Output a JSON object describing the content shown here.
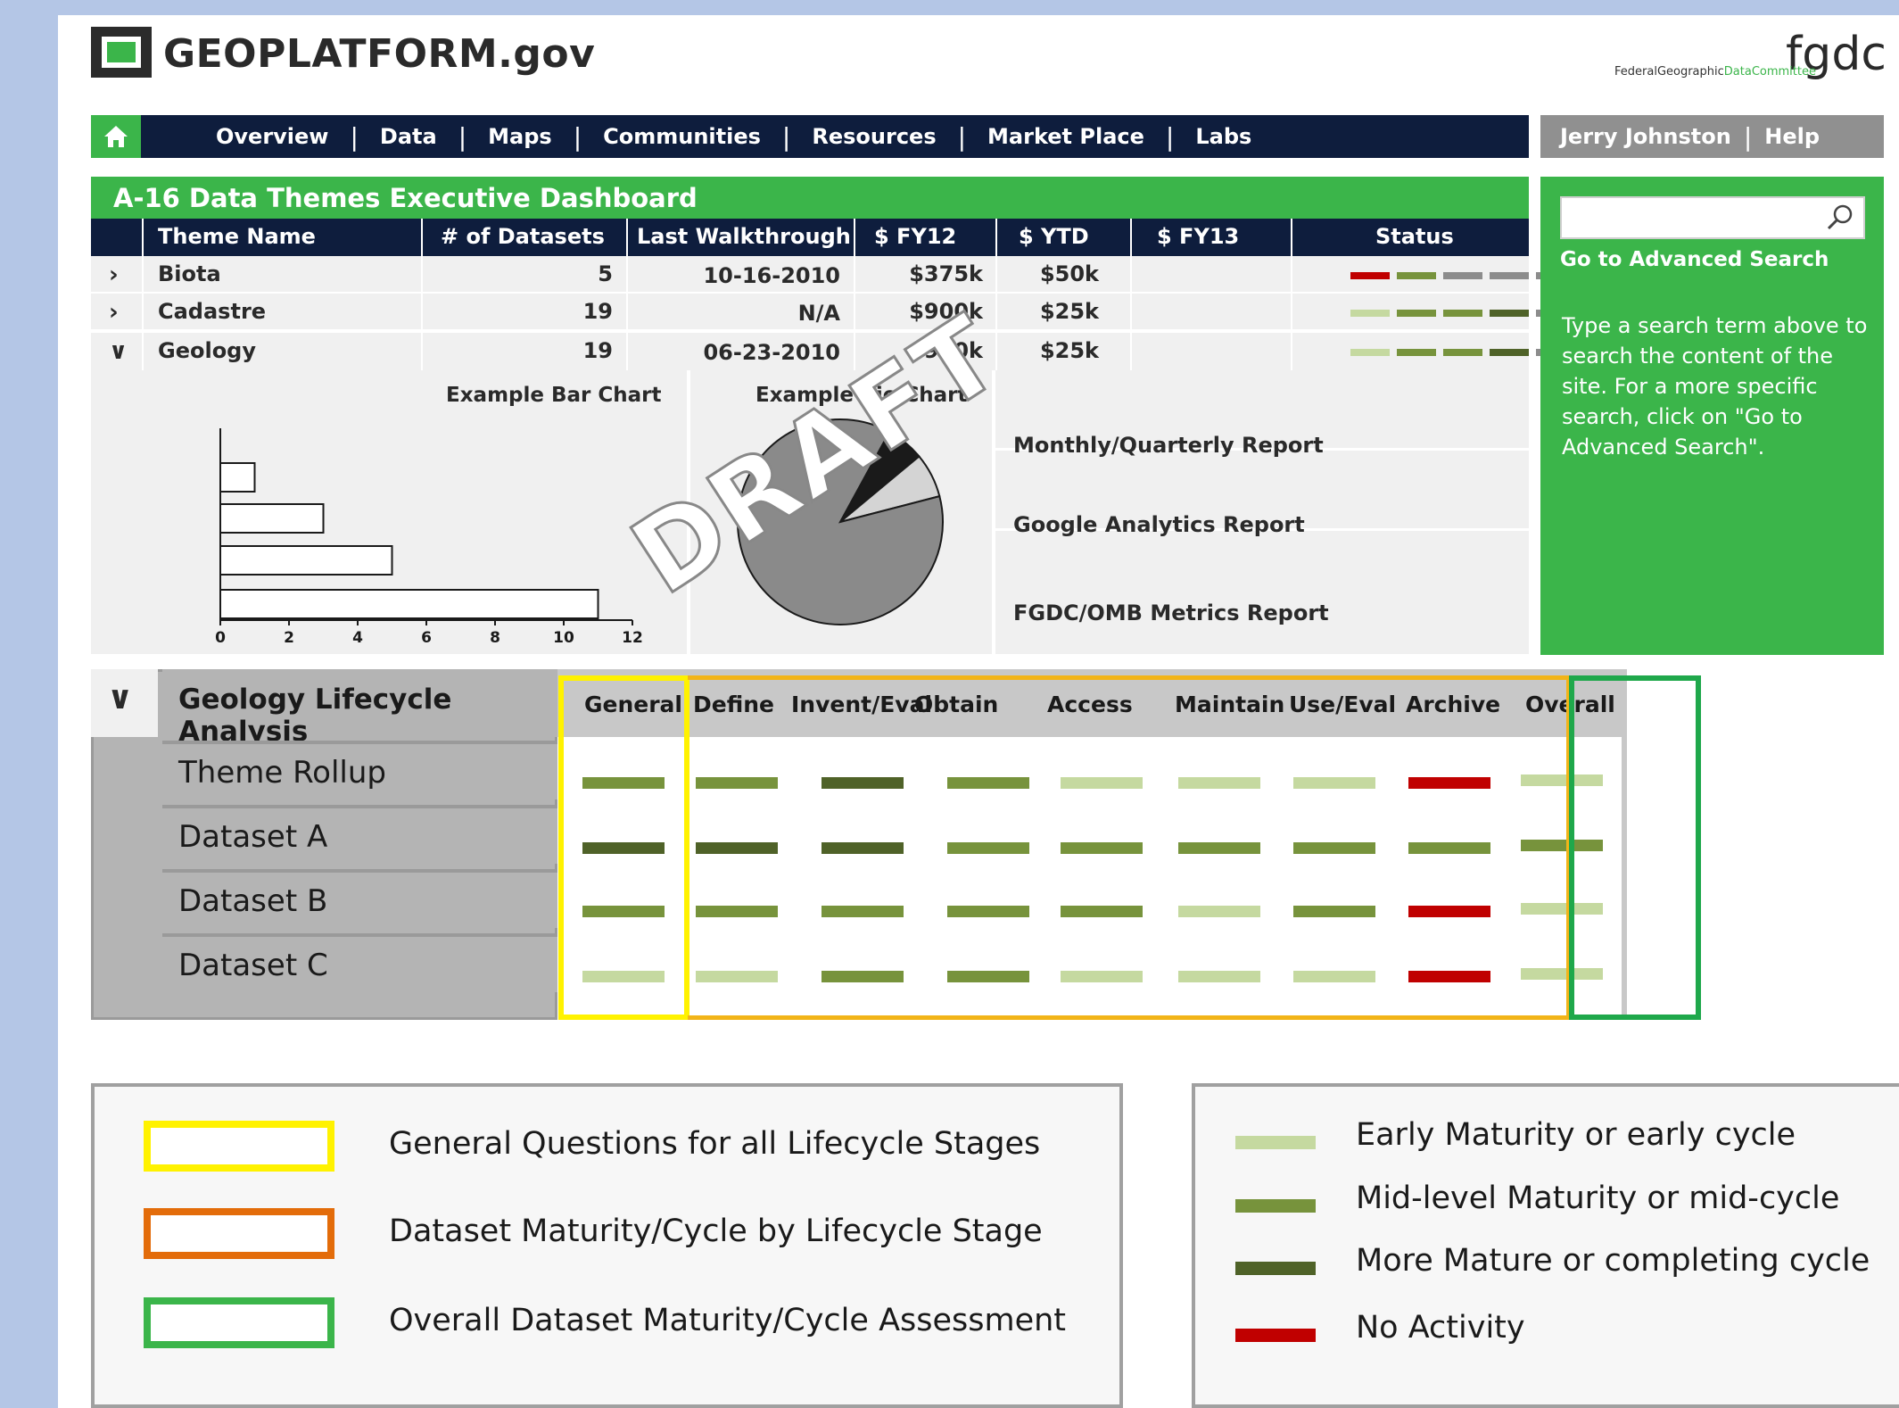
{
  "header": {
    "site_title": "GEOPLATFORM.gov",
    "partner_logo": "fgdc",
    "partner_sub_1": "FederalGeographic",
    "partner_sub_2": "DataCommittee"
  },
  "nav": {
    "home_icon": "home-icon",
    "items": [
      "Overview",
      "Data",
      "Maps",
      "Communities",
      "Resources",
      "Market Place",
      "Labs"
    ],
    "user": "Jerry Johnston",
    "help": "Help"
  },
  "dashboard": {
    "title": "A-16 Data Themes Executive Dashboard",
    "columns": [
      "Theme Name",
      "# of Datasets",
      "Last Walkthrough",
      "$ FY12",
      "$ YTD",
      "$ FY13",
      "Status"
    ],
    "rows": [
      {
        "expanded": false,
        "chevron": "›",
        "name": "Biota",
        "datasets": "5",
        "walkthrough": "10-16-2010",
        "fy12": "$375k",
        "ytd": "$50k",
        "fy13": "",
        "status": [
          "red",
          "mid",
          "gray",
          "gray",
          "gray"
        ]
      },
      {
        "expanded": false,
        "chevron": "›",
        "name": "Cadastre",
        "datasets": "19",
        "walkthrough": "N/A",
        "fy12": "$900k",
        "ytd": "$25k",
        "fy13": "",
        "status": [
          "light",
          "mid",
          "mid",
          "dark",
          "gray"
        ]
      },
      {
        "expanded": true,
        "chevron": "∨",
        "name": "Geology",
        "datasets": "19",
        "walkthrough": "06-23-2010",
        "fy12": "$900k",
        "ytd": "$25k",
        "fy13": "",
        "status": [
          "light",
          "mid",
          "mid",
          "dark",
          "gray"
        ]
      }
    ]
  },
  "bar_chart": {
    "title": "Example Bar Chart",
    "ticks": [
      "0",
      "2",
      "4",
      "6",
      "8",
      "10",
      "12"
    ]
  },
  "pie_chart": {
    "title": "Example Pie Chart"
  },
  "chart_data": [
    {
      "type": "bar",
      "title": "Example Bar Chart",
      "orientation": "horizontal",
      "values": [
        1,
        3,
        5,
        11
      ],
      "xlim": [
        0,
        12
      ]
    },
    {
      "type": "pie",
      "title": "Example Pie Chart",
      "values": [
        6,
        7,
        87
      ]
    }
  ],
  "watermark": "DRAFT",
  "reports": [
    "Monthly/Quarterly Report",
    "Google Analytics Report",
    "FGDC/OMB Metrics Report"
  ],
  "search": {
    "placeholder": "",
    "icon": "search-icon",
    "advanced_link": "Go to Advanced Search",
    "help_text": "Type a search term above to search the content of the site.  For a more specific search, click on \"Go to Advanced Search\"."
  },
  "lifecycle": {
    "title": "Geology Lifecycle Analysis",
    "columns": [
      "General",
      "Define",
      "Invent/Eval",
      "Obtain",
      "Access",
      "Maintain",
      "Use/Eval",
      "Archive",
      "Overall"
    ],
    "rows": [
      {
        "label": "Theme Rollup",
        "cells": [
          "mid",
          "mid",
          "dark",
          "mid",
          "light",
          "light",
          "light",
          "red",
          "light"
        ]
      },
      {
        "label": "Dataset A",
        "cells": [
          "dark",
          "dark",
          "dark",
          "mid",
          "mid",
          "mid",
          "mid",
          "mid",
          "mid"
        ]
      },
      {
        "label": "Dataset B",
        "cells": [
          "mid",
          "mid",
          "mid",
          "mid",
          "mid",
          "light",
          "mid",
          "red",
          "light"
        ]
      },
      {
        "label": "Dataset C",
        "cells": [
          "light",
          "light",
          "mid",
          "mid",
          "light",
          "light",
          "light",
          "red",
          "light"
        ]
      }
    ]
  },
  "legend_boxes": [
    {
      "color": "#fff200",
      "label": "General Questions for all Lifecycle Stages"
    },
    {
      "color": "#e36c0a",
      "label": "Dataset Maturity/Cycle by Lifecycle Stage"
    },
    {
      "color": "#3bb54a",
      "label": "Overall Dataset Maturity/Cycle Assessment"
    }
  ],
  "legend_levels": [
    {
      "level": "light",
      "label": "Early Maturity or early cycle"
    },
    {
      "level": "mid",
      "label": "Mid-level Maturity  or mid-cycle"
    },
    {
      "level": "dark",
      "label": "More Mature or completing cycle"
    },
    {
      "level": "red",
      "label": "No Activity"
    }
  ],
  "colors": {
    "light": "#c5d9a0",
    "mid": "#77933c",
    "dark": "#4f6228",
    "red": "#c00000",
    "gray": "#8c8c8c",
    "brand_green": "#3bb54a",
    "nav_navy": "#0e1d3d"
  }
}
